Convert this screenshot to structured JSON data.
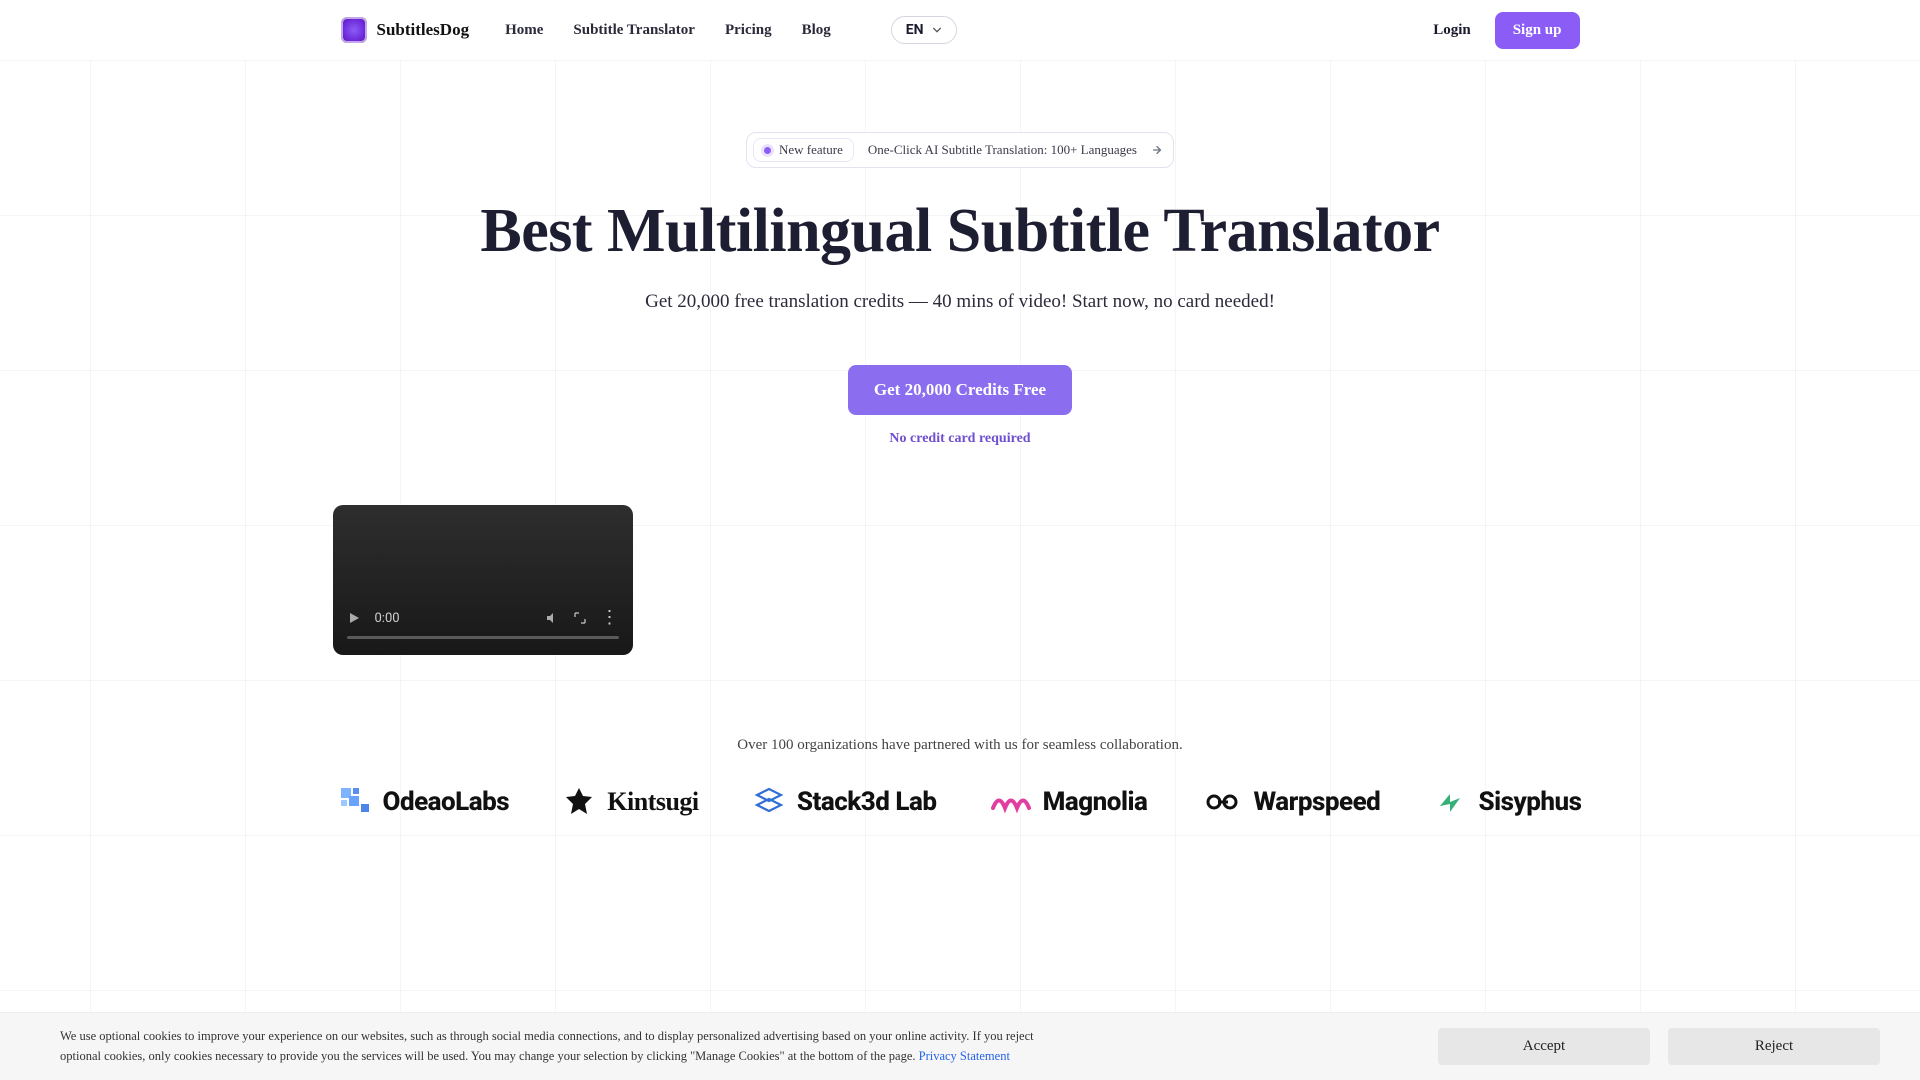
{
  "brand": {
    "name": "SubtitlesDog"
  },
  "nav": {
    "links": [
      "Home",
      "Subtitle Translator",
      "Pricing",
      "Blog"
    ],
    "lang": "EN",
    "login": "Login",
    "signup": "Sign up"
  },
  "badge": {
    "pill": "New feature",
    "text": "One-Click AI Subtitle Translation: 100+ Languages"
  },
  "hero": {
    "title": "Best Multilingual Subtitle Translator",
    "subtitle": "Get 20,000 free translation credits — 40 mins of video! Start now, no card needed!",
    "cta": "Get 20,000 Credits Free",
    "cta_note": "No credit card required"
  },
  "video": {
    "time": "0:00"
  },
  "partners": {
    "text": "Over 100 organizations have partnered with us for seamless collaboration.",
    "logos": [
      "OdeaoLabs",
      "Kintsugi",
      "Stack3d Lab",
      "Magnolia",
      "Warpspeed",
      "Sisyphus"
    ]
  },
  "cookie": {
    "text": "We use optional cookies to improve your experience on our websites, such as through social media connections, and to display personalized advertising based on your online activity. If you reject optional cookies, only cookies necessary to provide you the services will be used. You may change your selection by clicking \"Manage Cookies\" at the bottom of the page. ",
    "link": "Privacy Statement",
    "accept": "Accept",
    "reject": "Reject"
  }
}
